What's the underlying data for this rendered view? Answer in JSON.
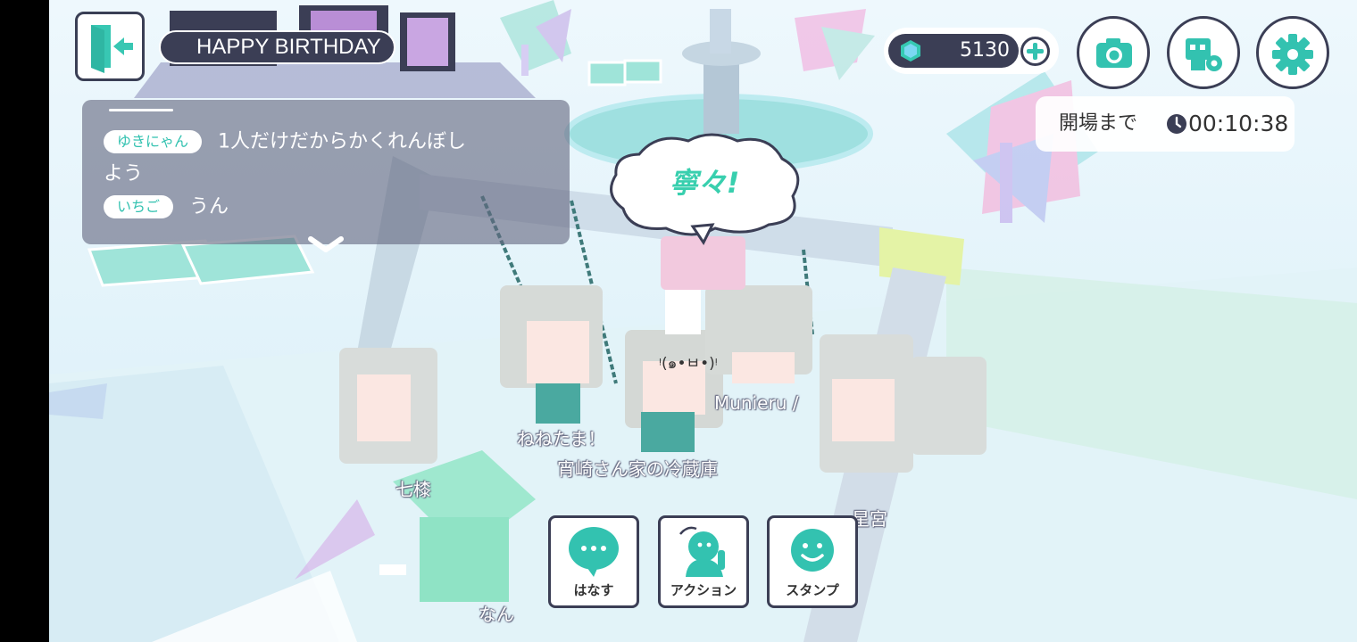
{
  "header": {
    "exit_icon": "exit-door-icon",
    "title_banner": "HAPPY BIRTHDAY"
  },
  "chat": {
    "messages": [
      {
        "name": "ゆきにゃん",
        "text": "1人だけだからかくれんぼし"
      },
      {
        "name": "",
        "text": "よう"
      },
      {
        "name": "いちご",
        "text": "うん"
      }
    ],
    "expand_icon": "chevron-down-icon"
  },
  "currency": {
    "icon": "gem-icon",
    "amount": "5130",
    "add_icon": "plus-icon"
  },
  "toolbar": {
    "camera_icon": "camera-icon",
    "avatar_settings_icon": "avatar-settings-icon",
    "settings_icon": "gear-icon"
  },
  "countdown": {
    "label": "開場まで",
    "clock_icon": "clock-icon",
    "time": "00:10:38"
  },
  "scene": {
    "speech_bubble": "寧々!",
    "emote": "ᵎ(๑•ㅂ•)ᵎ",
    "player_names": [
      "ねねたま！",
      "宵崎さん家の冷蔵庫",
      "Munieru /",
      "七㯃",
      "星宮",
      "なん"
    ]
  },
  "actions": [
    {
      "label": "はなす",
      "icon": "speech-bubble-icon"
    },
    {
      "label": "アクション",
      "icon": "action-person-icon"
    },
    {
      "label": "スタンプ",
      "icon": "smile-stamp-icon"
    }
  ],
  "colors": {
    "accent": "#33c2b0",
    "dark": "#3b3e55",
    "sky": "#e6f4fb"
  }
}
